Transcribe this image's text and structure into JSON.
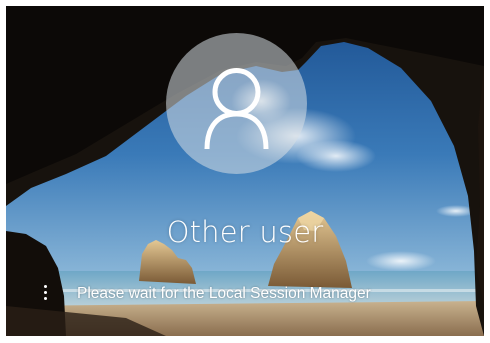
{
  "login": {
    "user_name": "Other user",
    "status_message": "Please wait for the Local Session Manager"
  },
  "icons": {
    "avatar": "user-silhouette-icon",
    "spinner": "loading-dots-icon"
  },
  "colors": {
    "text": "#ffffff",
    "avatar_circle": "rgba(215,222,228,0.55)"
  }
}
